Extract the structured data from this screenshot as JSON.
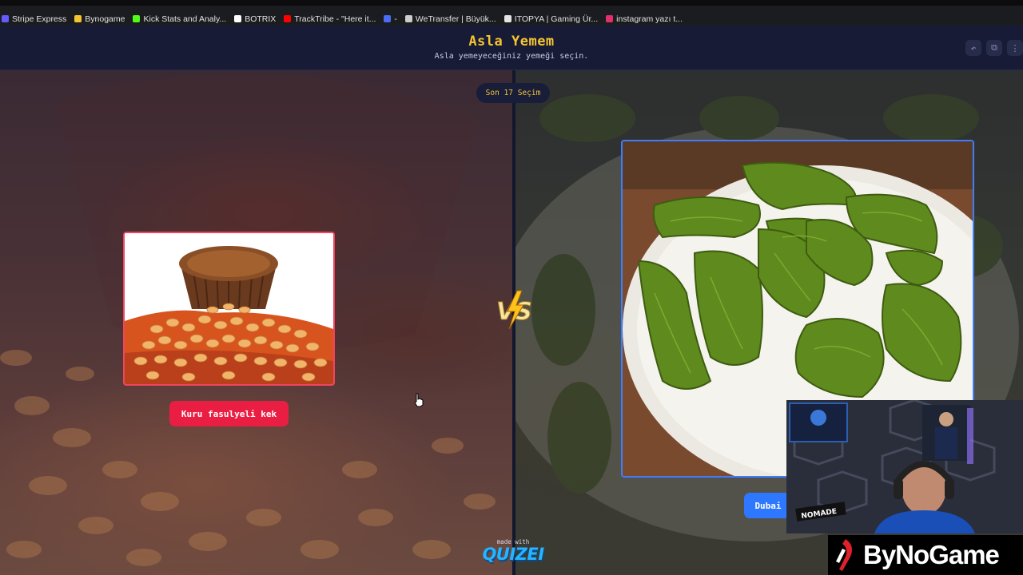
{
  "bookmarks": [
    {
      "label": "Stripe Express",
      "color": "#635bff"
    },
    {
      "label": "Bynogame",
      "color": "#f5c431"
    },
    {
      "label": "Kick Stats and Analy...",
      "color": "#53fc18"
    },
    {
      "label": "BOTRIX",
      "color": "#ffffff"
    },
    {
      "label": "TrackTribe - \"Here it...",
      "color": "#ff0000"
    },
    {
      "label": "-",
      "color": "#4a6cf7"
    },
    {
      "label": "WeTransfer | Büyük...",
      "color": "#cccccc"
    },
    {
      "label": "ITOPYA | Gaming Ür...",
      "color": "#e4e4e4"
    },
    {
      "label": "instagram yazı t...",
      "color": "#e1306c"
    }
  ],
  "header": {
    "title": "Asla Yemem",
    "subtitle": "Asla yemeyeceğiniz yemeği seçin.",
    "actions": [
      {
        "icon": "undo-icon",
        "glyph": "↶"
      },
      {
        "icon": "share-icon",
        "glyph": "⧉"
      },
      {
        "icon": "more-icon",
        "glyph": "⋮"
      }
    ]
  },
  "game": {
    "recent_label": "Son 17 Seçim",
    "left": {
      "name": "Kuru fasulyeli kek",
      "accent": "#ea1d43"
    },
    "right": {
      "name": "Dubai",
      "accent": "#2e78ff"
    },
    "vs_label": "VS"
  },
  "footer": {
    "made_with": "made with",
    "brand": "QUIZEI"
  },
  "overlay": {
    "webcam_badge": "NOMADE",
    "brand_text": "ByNoGame"
  }
}
